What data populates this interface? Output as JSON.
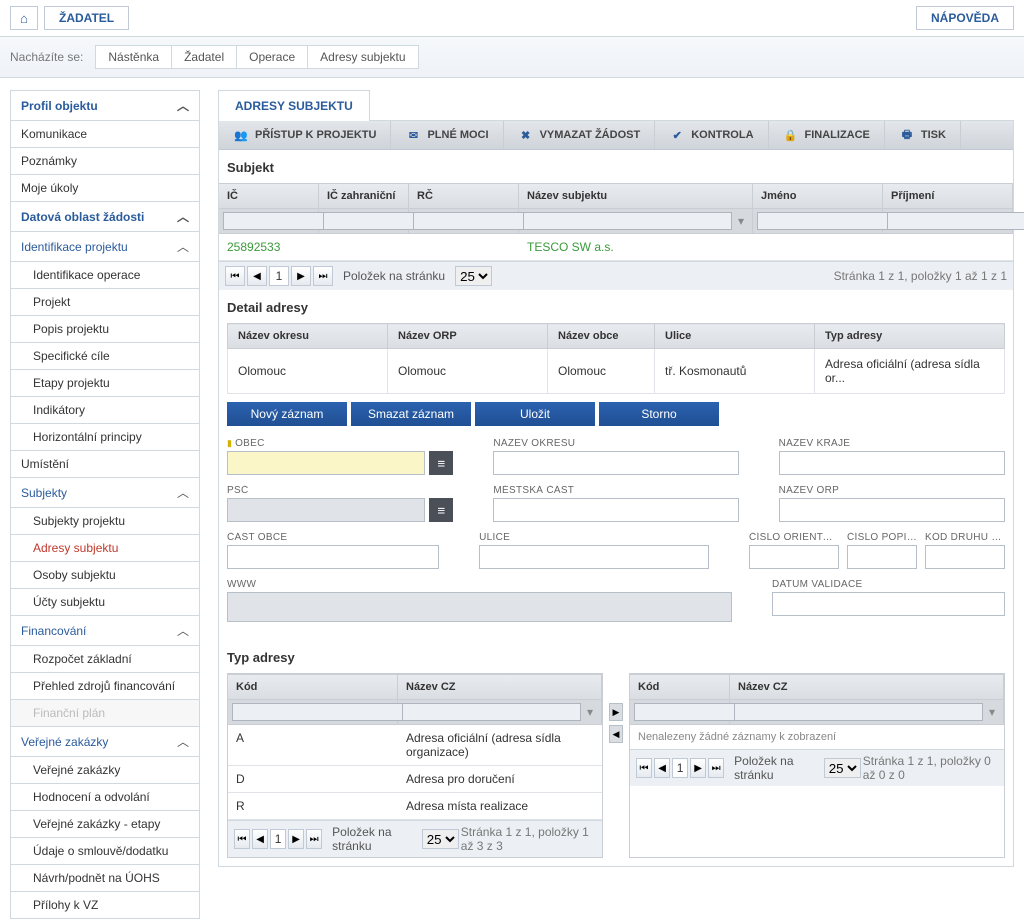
{
  "top": {
    "zadatel": "ŽADATEL",
    "napoveda": "NÁPOVĚDA"
  },
  "breadcrumb": {
    "label": "Nacházíte se:",
    "items": [
      "Nástěnka",
      "Žadatel",
      "Operace",
      "Adresy subjektu"
    ]
  },
  "sidebar": {
    "profil": "Profil objektu",
    "komunikace": "Komunikace",
    "poznamky": "Poznámky",
    "ukoly": "Moje úkoly",
    "datova": "Datová oblast žádosti",
    "ident": "Identifikace projektu",
    "identop": "Identifikace operace",
    "projekt": "Projekt",
    "popis": "Popis projektu",
    "spec": "Specifické cíle",
    "etapy": "Etapy projektu",
    "indik": "Indikátory",
    "horiz": "Horizontální principy",
    "umisteni": "Umístění",
    "subjekty": "Subjekty",
    "subjp": "Subjekty projektu",
    "adresy": "Adresy subjektu",
    "osoby": "Osoby subjektu",
    "ucty": "Účty subjektu",
    "finan": "Financování",
    "rozpocet": "Rozpočet základní",
    "prehled": "Přehled zdrojů financování",
    "finplan": "Finanční plán",
    "vz": "Veřejné zakázky",
    "vz1": "Veřejné zakázky",
    "hodn": "Hodnocení a odvolání",
    "vzetapy": "Veřejné zakázky - etapy",
    "udaje": "Údaje o smlouvě/dodatku",
    "navrh": "Návrh/podnět na ÚOHS",
    "prilohy": "Přílohy k VZ"
  },
  "page": {
    "title": "ADRESY SUBJEKTU"
  },
  "toolbar": {
    "pristup": "PŘÍSTUP K PROJEKTU",
    "plne": "PLNÉ MOCI",
    "vymazat": "VYMAZAT ŽÁDOST",
    "kontrola": "KONTROLA",
    "finalizace": "FINALIZACE",
    "tisk": "TISK"
  },
  "sekce": {
    "subjekt": "Subjekt",
    "detail": "Detail adresy",
    "typ": "Typ adresy"
  },
  "subjGrid": {
    "cols": {
      "ic": "IČ",
      "icz": "IČ zahraniční",
      "rc": "RČ",
      "nazev": "Název subjektu",
      "jmeno": "Jméno",
      "prijmeni": "Příjmení"
    },
    "row": {
      "ic": "25892533",
      "nazev": "TESCO SW a.s."
    },
    "pagerLabel": "Položek na stránku",
    "pagerSel": "25",
    "info": "Stránka 1 z 1, položky 1 až 1 z 1"
  },
  "detGrid": {
    "cols": {
      "okres": "Název okresu",
      "orp": "Název ORP",
      "obce": "Název obce",
      "ulice": "Ulice",
      "typ": "Typ adresy"
    },
    "row": {
      "okres": "Olomouc",
      "orp": "Olomouc",
      "obce": "Olomouc",
      "ulice": "tř. Kosmonautů",
      "typ": "Adresa oficiální (adresa sídla or..."
    }
  },
  "actions": {
    "novy": "Nový záznam",
    "smazat": "Smazat záznam",
    "ulozit": "Uložit",
    "storno": "Storno"
  },
  "form": {
    "obec": "OBEC",
    "nazokr": "NÁZEV OKRESU",
    "nazkraj": "NÁZEV KRAJE",
    "psc": "PSČ",
    "mcast": "MĚSTSKÁ ČÁST",
    "nazorp": "NÁZEV ORP",
    "castobce": "ČÁST OBCE",
    "ulice": "ULICE",
    "cislor": "ČÍSLO ORIENTAČNÍ",
    "cislop": "ČÍSLO POPISNÉ/ EVIDENČNÍ",
    "kod": "KÓD DRUHU ČÍSLA DOMOVNÍHO",
    "www": "WWW",
    "datum": "DATUM VALIDACE"
  },
  "typGrid": {
    "cols": {
      "kod": "Kód",
      "nazev": "Název CZ"
    },
    "rows": [
      {
        "kod": "A",
        "nazev": "Adresa oficiální (adresa sídla organizace)"
      },
      {
        "kod": "D",
        "nazev": "Adresa pro doručení"
      },
      {
        "kod": "R",
        "nazev": "Adresa místa realizace"
      }
    ],
    "pagerLabel": "Položek na stránku",
    "pagerSel": "25",
    "info": "Stránka 1 z 1, položky 1 až 3 z 3",
    "nodata": "Nenalezeny žádné záznamy k zobrazení",
    "info2": "Stránka 1 z 1, položky 0 až 0 z 0"
  }
}
